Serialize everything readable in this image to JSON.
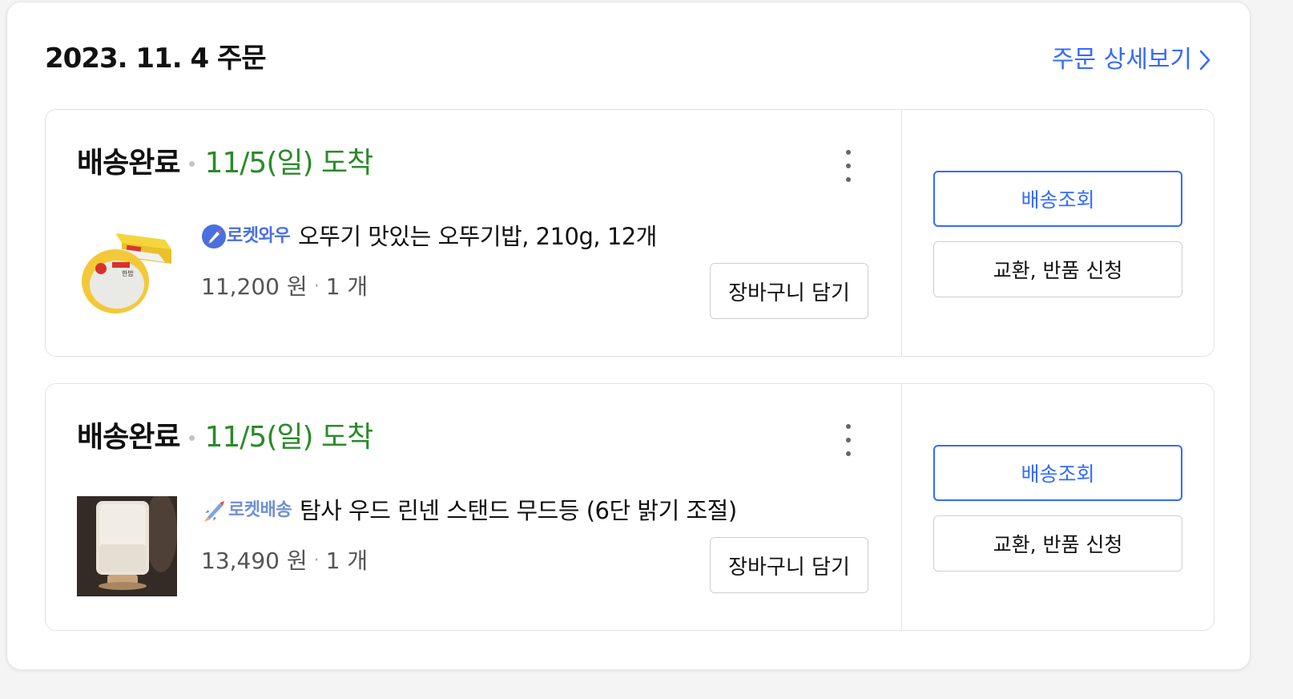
{
  "order": {
    "date_title": "2023. 11. 4 주문",
    "detail_link": "주문 상세보기"
  },
  "shipments": [
    {
      "status": "배송완료",
      "arrival": "11/5(일) 도착",
      "badge": "로켓와우",
      "product_name": "오뚜기 맛있는 오뚜기밥, 210g, 12개",
      "price": "11,200 원",
      "quantity": "1 개",
      "cart_button": "장바구니 담기",
      "track_button": "배송조회",
      "return_button": "교환, 반품 신청",
      "thumb_label": "즉석밥 이미지",
      "thumb_text": "한밥"
    },
    {
      "status": "배송완료",
      "arrival": "11/5(일) 도착",
      "badge": "로켓배송",
      "product_name": "탐사 우드 린넨 스탠드 무드등 (6단 밝기 조절)",
      "price": "13,490 원",
      "quantity": "1 개",
      "cart_button": "장바구니 담기",
      "track_button": "배송조회",
      "return_button": "교환, 반품 신청"
    }
  ],
  "colors": {
    "accent_blue": "#346aff",
    "arrival_green": "#2b8a2b",
    "text_dark": "#111111",
    "border": "#e2e2e2"
  },
  "icons": {
    "more": "more-vertical-icon",
    "chevron": "chevron-right-icon",
    "rocket_wow": "rocket-wow-icon",
    "rocket": "rocket-icon"
  }
}
